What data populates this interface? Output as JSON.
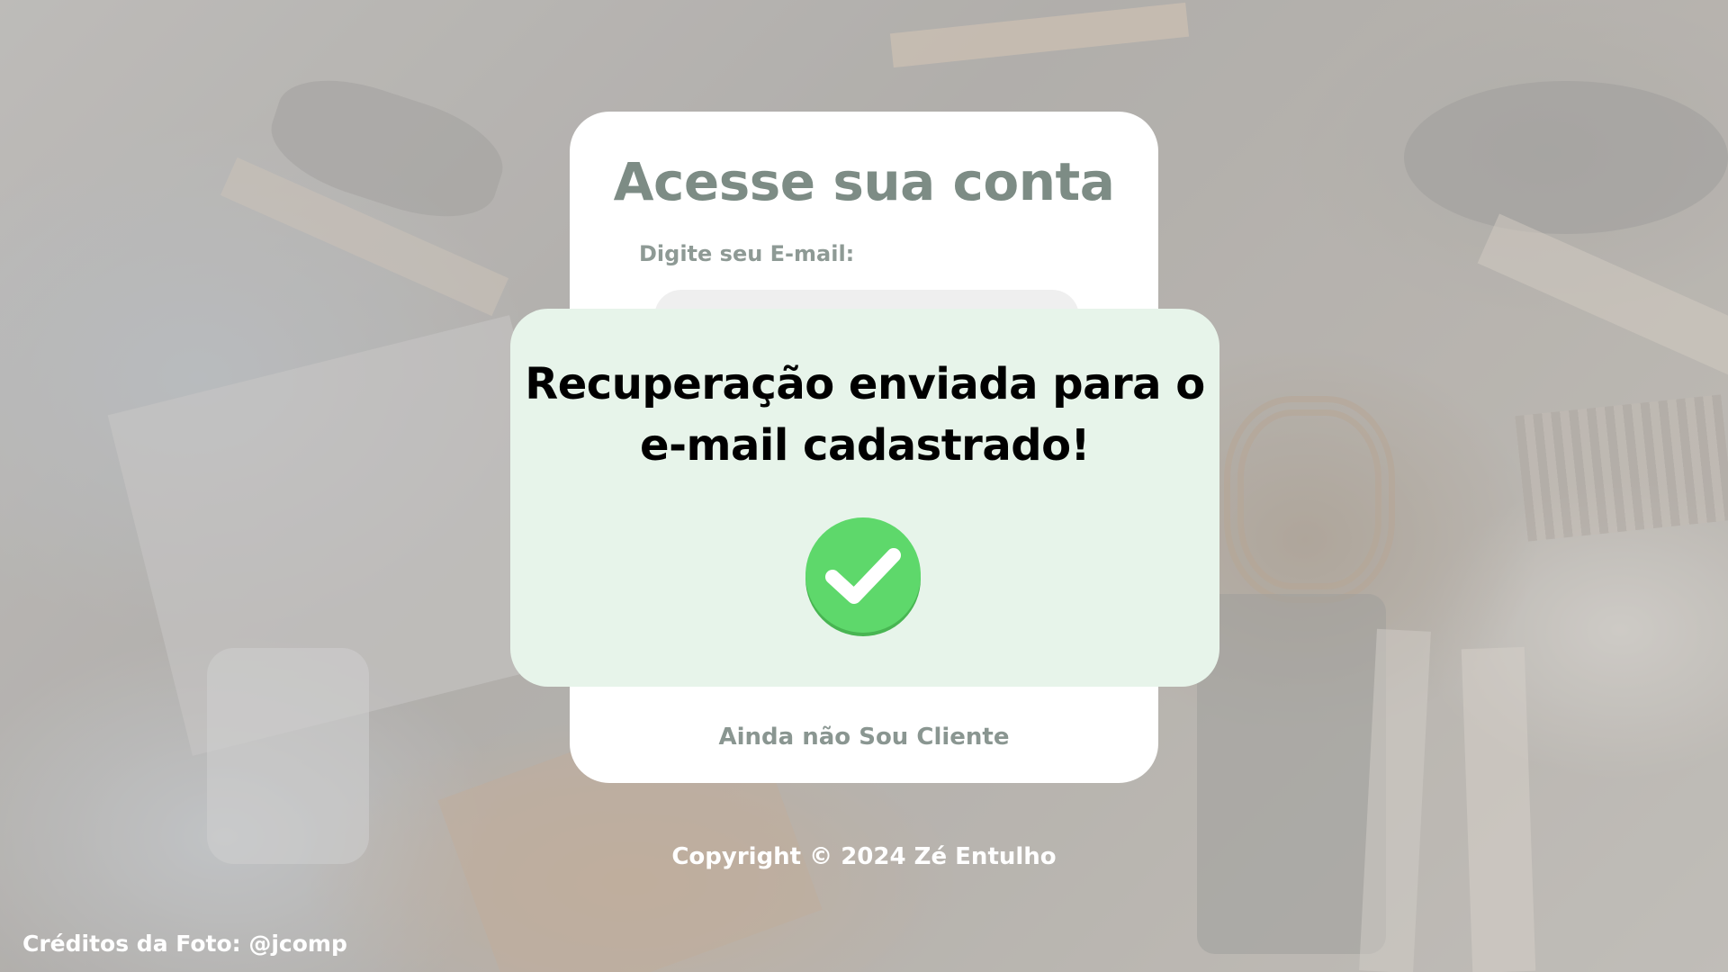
{
  "login": {
    "title": "Acesse sua conta",
    "email_label": "Digite seu E-mail:",
    "email_value": "",
    "email_placeholder": "",
    "signup_link": "Ainda não Sou Cliente"
  },
  "modal": {
    "message": "Recuperação enviada para o e-mail cadastrado!",
    "icon": "check-circle-icon",
    "icon_color": "#5ed86b",
    "background_color": "#e7f4ea"
  },
  "footer": {
    "copyright": "Copyright © 2024 Zé Entulho",
    "photo_credit": "Créditos da Foto: @jcomp"
  },
  "colors": {
    "title": "#7d8c85",
    "card": "#ffffff"
  }
}
